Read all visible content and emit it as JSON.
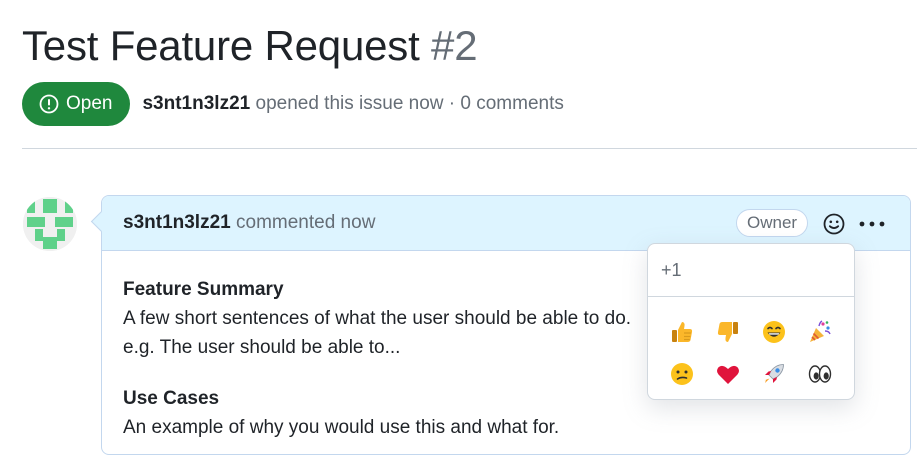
{
  "issue": {
    "title": "Test Feature Request",
    "number": "#2",
    "state_label": "Open",
    "state_color": "#1f883d",
    "author": "s3nt1n3lz21",
    "meta_suffix": "opened this issue now · 0 comments"
  },
  "comment": {
    "author": "s3nt1n3lz21",
    "action": "commented now",
    "role_badge": "Owner",
    "body": {
      "section1_heading": "Feature Summary",
      "section1_line1": "A few short sentences of what the user should be able to do.",
      "section1_line2": "e.g. The user should be able to...",
      "section2_heading": "Use Cases",
      "section2_line1": "An example of why you would use this and what for."
    }
  },
  "reactions_menu": {
    "hover_label": "+1",
    "items": [
      {
        "name": "+1",
        "icon": "thumbs-up-icon"
      },
      {
        "name": "-1",
        "icon": "thumbs-down-icon"
      },
      {
        "name": "laugh",
        "icon": "smile-icon"
      },
      {
        "name": "hooray",
        "icon": "party-popper-icon"
      },
      {
        "name": "confused",
        "icon": "confused-face-icon"
      },
      {
        "name": "heart",
        "icon": "heart-icon"
      },
      {
        "name": "rocket",
        "icon": "rocket-icon"
      },
      {
        "name": "eyes",
        "icon": "eyes-icon"
      }
    ]
  },
  "colors": {
    "accent_green": "#1f883d",
    "header_blue": "#ddf4ff",
    "border_blue": "#c3d7ee",
    "muted_text": "#656d76"
  }
}
